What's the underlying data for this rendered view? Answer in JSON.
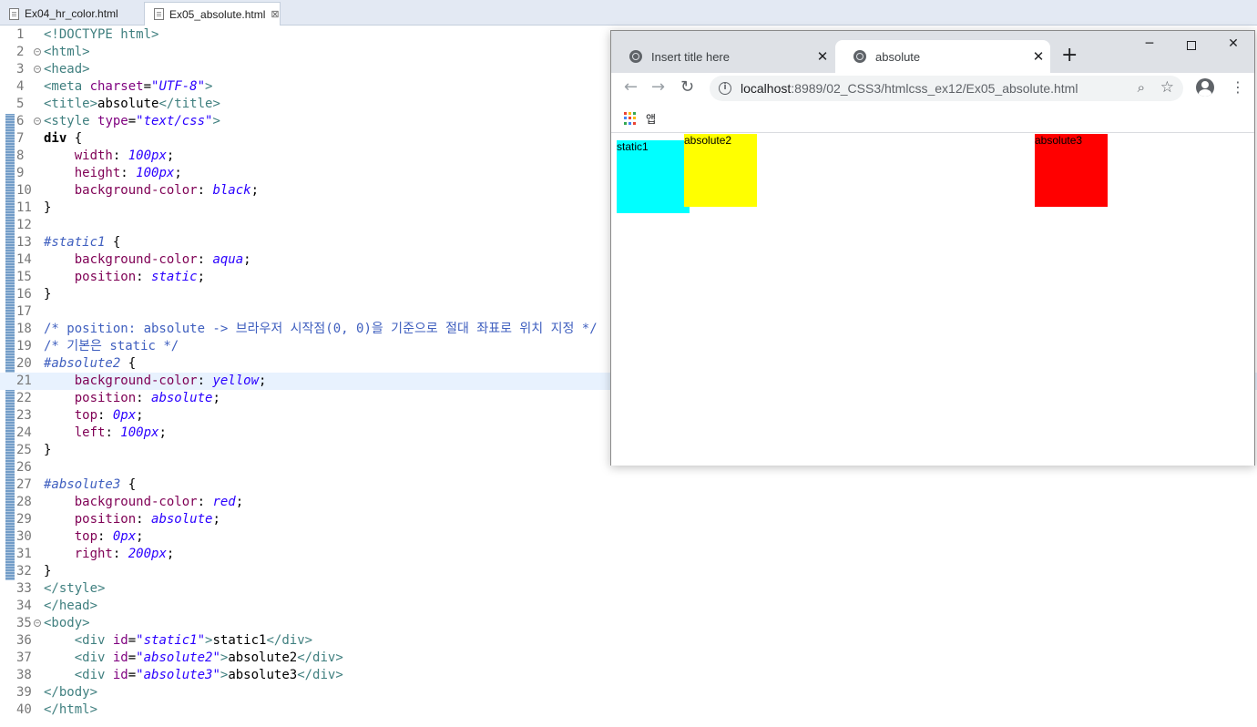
{
  "editor": {
    "tabs": [
      {
        "label": "Ex04_hr_color.html",
        "active": false
      },
      {
        "label": "Ex05_absolute.html",
        "active": true
      }
    ],
    "lines": [
      {
        "n": "1",
        "fold": false,
        "hl": false,
        "tokens": [
          [
            "t-tag",
            "<!DOCTYPE html>"
          ]
        ]
      },
      {
        "n": "2",
        "fold": true,
        "hl": false,
        "tokens": [
          [
            "t-tag",
            "<html>"
          ]
        ]
      },
      {
        "n": "3",
        "fold": true,
        "hl": false,
        "tokens": [
          [
            "t-tag",
            "<head>"
          ]
        ]
      },
      {
        "n": "4",
        "fold": false,
        "hl": false,
        "tokens": [
          [
            "t-tag",
            "<meta "
          ],
          [
            "t-attr",
            "charset"
          ],
          [
            "t-txt",
            "="
          ],
          [
            "t-str",
            "\"UTF-8\""
          ],
          [
            "t-tag",
            ">"
          ]
        ]
      },
      {
        "n": "5",
        "fold": false,
        "hl": false,
        "tokens": [
          [
            "t-tag",
            "<title>"
          ],
          [
            "t-txt",
            "absolute"
          ],
          [
            "t-tag",
            "</title>"
          ]
        ]
      },
      {
        "n": "6",
        "fold": true,
        "hl": false,
        "tokens": [
          [
            "t-tag",
            "<style "
          ],
          [
            "t-attr",
            "type"
          ],
          [
            "t-txt",
            "="
          ],
          [
            "t-str",
            "\"text/css\""
          ],
          [
            "t-tag",
            ">"
          ]
        ]
      },
      {
        "n": "7",
        "fold": false,
        "hl": false,
        "tokens": [
          [
            "t-kw",
            "div"
          ],
          [
            "t-txt",
            " {"
          ]
        ]
      },
      {
        "n": "8",
        "fold": false,
        "hl": false,
        "tokens": [
          [
            "t-txt",
            "    "
          ],
          [
            "t-prop",
            "width"
          ],
          [
            "t-txt",
            ": "
          ],
          [
            "t-val",
            "100px"
          ],
          [
            "t-txt",
            ";"
          ]
        ]
      },
      {
        "n": "9",
        "fold": false,
        "hl": false,
        "tokens": [
          [
            "t-txt",
            "    "
          ],
          [
            "t-prop",
            "height"
          ],
          [
            "t-txt",
            ": "
          ],
          [
            "t-val",
            "100px"
          ],
          [
            "t-txt",
            ";"
          ]
        ]
      },
      {
        "n": "10",
        "fold": false,
        "hl": false,
        "tokens": [
          [
            "t-txt",
            "    "
          ],
          [
            "t-prop",
            "background-color"
          ],
          [
            "t-txt",
            ": "
          ],
          [
            "t-val",
            "black"
          ],
          [
            "t-txt",
            ";"
          ]
        ]
      },
      {
        "n": "11",
        "fold": false,
        "hl": false,
        "tokens": [
          [
            "t-txt",
            "}"
          ]
        ]
      },
      {
        "n": "12",
        "fold": false,
        "hl": false,
        "tokens": []
      },
      {
        "n": "13",
        "fold": false,
        "hl": false,
        "tokens": [
          [
            "t-sel",
            "#static1"
          ],
          [
            "t-txt",
            " {"
          ]
        ]
      },
      {
        "n": "14",
        "fold": false,
        "hl": false,
        "tokens": [
          [
            "t-txt",
            "    "
          ],
          [
            "t-prop",
            "background-color"
          ],
          [
            "t-txt",
            ": "
          ],
          [
            "t-val",
            "aqua"
          ],
          [
            "t-txt",
            ";"
          ]
        ]
      },
      {
        "n": "15",
        "fold": false,
        "hl": false,
        "tokens": [
          [
            "t-txt",
            "    "
          ],
          [
            "t-prop",
            "position"
          ],
          [
            "t-txt",
            ": "
          ],
          [
            "t-val",
            "static"
          ],
          [
            "t-txt",
            ";"
          ]
        ]
      },
      {
        "n": "16",
        "fold": false,
        "hl": false,
        "tokens": [
          [
            "t-txt",
            "}"
          ]
        ]
      },
      {
        "n": "17",
        "fold": false,
        "hl": false,
        "tokens": []
      },
      {
        "n": "18",
        "fold": false,
        "hl": false,
        "tokens": [
          [
            "t-cmt",
            "/* position: absolute -> 브라우저 시작점(0, 0)을 기준으로 절대 좌표로 위치 지정 */"
          ]
        ]
      },
      {
        "n": "19",
        "fold": false,
        "hl": false,
        "tokens": [
          [
            "t-cmt",
            "/* 기본은 static */"
          ]
        ]
      },
      {
        "n": "20",
        "fold": false,
        "hl": false,
        "tokens": [
          [
            "t-sel",
            "#absolute2"
          ],
          [
            "t-txt",
            " {"
          ]
        ]
      },
      {
        "n": "21",
        "fold": false,
        "hl": true,
        "tokens": [
          [
            "t-txt",
            "    "
          ],
          [
            "t-prop",
            "background-color"
          ],
          [
            "t-txt",
            ": "
          ],
          [
            "t-val",
            "yellow"
          ],
          [
            "t-txt",
            ";"
          ]
        ]
      },
      {
        "n": "22",
        "fold": false,
        "hl": false,
        "tokens": [
          [
            "t-txt",
            "    "
          ],
          [
            "t-prop",
            "position"
          ],
          [
            "t-txt",
            ": "
          ],
          [
            "t-val",
            "absolute"
          ],
          [
            "t-txt",
            ";"
          ]
        ]
      },
      {
        "n": "23",
        "fold": false,
        "hl": false,
        "tokens": [
          [
            "t-txt",
            "    "
          ],
          [
            "t-prop",
            "top"
          ],
          [
            "t-txt",
            ": "
          ],
          [
            "t-val",
            "0px"
          ],
          [
            "t-txt",
            ";"
          ]
        ]
      },
      {
        "n": "24",
        "fold": false,
        "hl": false,
        "tokens": [
          [
            "t-txt",
            "    "
          ],
          [
            "t-prop",
            "left"
          ],
          [
            "t-txt",
            ": "
          ],
          [
            "t-val",
            "100px"
          ],
          [
            "t-txt",
            ";"
          ]
        ]
      },
      {
        "n": "25",
        "fold": false,
        "hl": false,
        "tokens": [
          [
            "t-txt",
            "}"
          ]
        ]
      },
      {
        "n": "26",
        "fold": false,
        "hl": false,
        "tokens": []
      },
      {
        "n": "27",
        "fold": false,
        "hl": false,
        "tokens": [
          [
            "t-sel",
            "#absolute3"
          ],
          [
            "t-txt",
            " {"
          ]
        ]
      },
      {
        "n": "28",
        "fold": false,
        "hl": false,
        "tokens": [
          [
            "t-txt",
            "    "
          ],
          [
            "t-prop",
            "background-color"
          ],
          [
            "t-txt",
            ": "
          ],
          [
            "t-val",
            "red"
          ],
          [
            "t-txt",
            ";"
          ]
        ]
      },
      {
        "n": "29",
        "fold": false,
        "hl": false,
        "tokens": [
          [
            "t-txt",
            "    "
          ],
          [
            "t-prop",
            "position"
          ],
          [
            "t-txt",
            ": "
          ],
          [
            "t-val",
            "absolute"
          ],
          [
            "t-txt",
            ";"
          ]
        ]
      },
      {
        "n": "30",
        "fold": false,
        "hl": false,
        "tokens": [
          [
            "t-txt",
            "    "
          ],
          [
            "t-prop",
            "top"
          ],
          [
            "t-txt",
            ": "
          ],
          [
            "t-val",
            "0px"
          ],
          [
            "t-txt",
            ";"
          ]
        ]
      },
      {
        "n": "31",
        "fold": false,
        "hl": false,
        "tokens": [
          [
            "t-txt",
            "    "
          ],
          [
            "t-prop",
            "right"
          ],
          [
            "t-txt",
            ": "
          ],
          [
            "t-val",
            "200px"
          ],
          [
            "t-txt",
            ";"
          ]
        ]
      },
      {
        "n": "32",
        "fold": false,
        "hl": false,
        "tokens": [
          [
            "t-txt",
            "}"
          ]
        ]
      },
      {
        "n": "33",
        "fold": false,
        "hl": false,
        "tokens": [
          [
            "t-tag",
            "</style>"
          ]
        ]
      },
      {
        "n": "34",
        "fold": false,
        "hl": false,
        "tokens": [
          [
            "t-tag",
            "</head>"
          ]
        ]
      },
      {
        "n": "35",
        "fold": true,
        "hl": false,
        "tokens": [
          [
            "t-tag",
            "<body>"
          ]
        ]
      },
      {
        "n": "36",
        "fold": false,
        "hl": false,
        "tokens": [
          [
            "t-txt",
            "    "
          ],
          [
            "t-tag",
            "<div "
          ],
          [
            "t-attr",
            "id"
          ],
          [
            "t-txt",
            "="
          ],
          [
            "t-str",
            "\"static1\""
          ],
          [
            "t-tag",
            ">"
          ],
          [
            "t-txt",
            "static1"
          ],
          [
            "t-tag",
            "</div>"
          ]
        ]
      },
      {
        "n": "37",
        "fold": false,
        "hl": false,
        "tokens": [
          [
            "t-txt",
            "    "
          ],
          [
            "t-tag",
            "<div "
          ],
          [
            "t-attr",
            "id"
          ],
          [
            "t-txt",
            "="
          ],
          [
            "t-str",
            "\"absolute2\""
          ],
          [
            "t-tag",
            ">"
          ],
          [
            "t-txt",
            "absolute2"
          ],
          [
            "t-tag",
            "</div>"
          ]
        ]
      },
      {
        "n": "38",
        "fold": false,
        "hl": false,
        "tokens": [
          [
            "t-txt",
            "    "
          ],
          [
            "t-tag",
            "<div "
          ],
          [
            "t-attr",
            "id"
          ],
          [
            "t-txt",
            "="
          ],
          [
            "t-str",
            "\"absolute3\""
          ],
          [
            "t-tag",
            ">"
          ],
          [
            "t-txt",
            "absolute3"
          ],
          [
            "t-tag",
            "</div>"
          ]
        ]
      },
      {
        "n": "39",
        "fold": false,
        "hl": false,
        "tokens": [
          [
            "t-tag",
            "</body>"
          ]
        ]
      },
      {
        "n": "40",
        "fold": false,
        "hl": false,
        "tokens": [
          [
            "t-tag",
            "</html>"
          ]
        ]
      }
    ]
  },
  "browser": {
    "tabs": [
      {
        "title": "Insert title here",
        "active": false
      },
      {
        "title": "absolute",
        "active": true
      }
    ],
    "new_tab": "+",
    "window": {
      "minimize": "─",
      "close": "✕"
    },
    "url_host": "localhost",
    "url_path": ":8989/02_CSS3/htmlcss_ex12/Ex05_absolute.html",
    "bookmarks_label": "앱",
    "page": {
      "boxes": [
        {
          "id": "static1",
          "label": "static1",
          "color": "#00ffff"
        },
        {
          "id": "absolute2",
          "label": "absolute2",
          "color": "#ffff00"
        },
        {
          "id": "absolute3",
          "label": "absolute3",
          "color": "#ff0000"
        }
      ]
    }
  },
  "colors": {
    "accent": "#3f5fbf",
    "apps_grid": [
      "#ea4335",
      "#fbbc05",
      "#34a853",
      "#4285f4",
      "#ea4335",
      "#fbbc05",
      "#34a853",
      "#4285f4",
      "#ea4335"
    ]
  }
}
